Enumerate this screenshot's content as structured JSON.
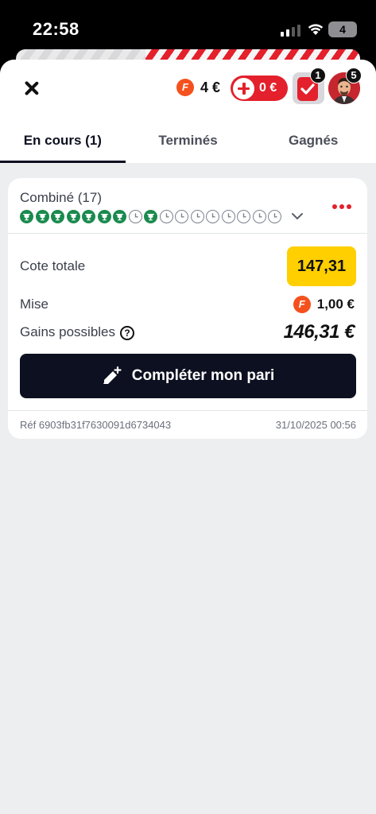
{
  "status_bar": {
    "time": "22:58",
    "battery": "4"
  },
  "header": {
    "balance_amount": "4 €",
    "coin_letter": "F",
    "deposit_label": "0 €",
    "betslip_badge": "1",
    "avatar_badge": "5"
  },
  "tabs": [
    {
      "label": "En cours (1)",
      "active": true
    },
    {
      "label": "Terminés",
      "active": false
    },
    {
      "label": "Gagnés",
      "active": false
    }
  ],
  "bet": {
    "title": "Combiné (17)",
    "legs": [
      "won",
      "won",
      "won",
      "won",
      "won",
      "won",
      "won",
      "pending",
      "won",
      "pending",
      "pending",
      "pending",
      "pending",
      "pending",
      "pending",
      "pending",
      "pending"
    ],
    "total_odds_label": "Cote totale",
    "total_odds_value": "147,31",
    "stake_label": "Mise",
    "stake_value": "1,00 €",
    "winnings_label": "Gains possibles",
    "winnings_help": "?",
    "winnings_value": "146,31 €",
    "complete_button": "Compléter mon pari",
    "reference": "Réf 6903fb31f7630091d6734043",
    "date": "31/10/2025 00:56"
  },
  "colors": {
    "brand_red": "#e3202b",
    "won_green": "#1a8a4e",
    "odds_yellow": "#ffcf00",
    "dark": "#0d1020"
  }
}
